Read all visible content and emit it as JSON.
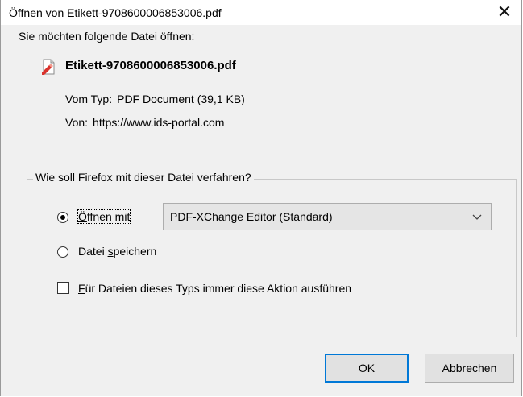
{
  "window": {
    "title": "Öffnen von Etikett-9708600006853006.pdf",
    "close_glyph": "✕"
  },
  "intro": {
    "question": "Sie möchten folgende Datei öffnen:"
  },
  "file": {
    "icon": "pdf-file-icon",
    "name": "Etikett-9708600006853006.pdf",
    "type_label": "Vom Typ:",
    "type_value": "PDF Document (39,1 KB)",
    "from_label": "Von:",
    "from_value": "https://www.ids-portal.com"
  },
  "action_group": {
    "legend": "Wie soll Firefox mit dieser Datei verfahren?",
    "open_with": {
      "accel": "Ö",
      "rest": "ffnen mit",
      "checked": true
    },
    "application_select": {
      "value": "PDF-XChange Editor (Standard)"
    },
    "save_file": {
      "pre": "Datei ",
      "accel": "s",
      "rest": "peichern",
      "checked": false
    },
    "always_do": {
      "accel": "F",
      "rest": "ür Dateien dieses Typs immer diese Aktion ausführen",
      "checked": false
    }
  },
  "buttons": {
    "ok": "OK",
    "cancel": "Abbrechen"
  },
  "colors": {
    "dialog_bg": "#f0f0f0",
    "default_button_border": "#0078d7",
    "pdf_icon_red": "#d9322c"
  }
}
